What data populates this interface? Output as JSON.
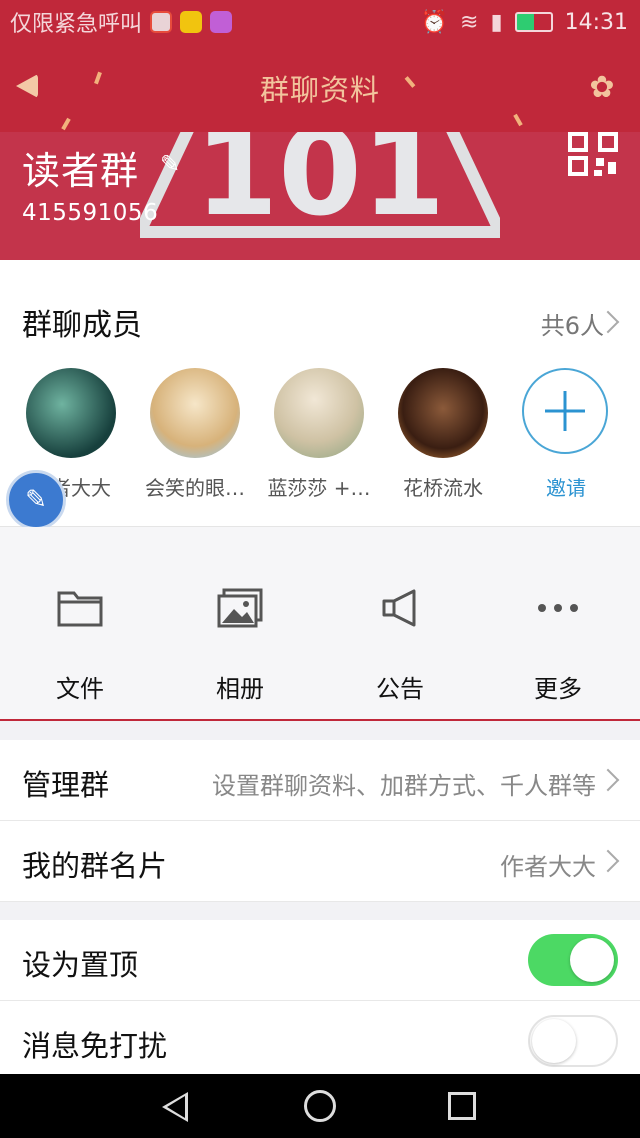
{
  "status_bar": {
    "carrier_text": "仅限紧急呼叫",
    "time": "14:31"
  },
  "navbar": {
    "title": "群聊资料"
  },
  "group": {
    "name": "读者群",
    "id": "415591056",
    "banner_text": "101"
  },
  "members": {
    "title": "群聊成员",
    "count": "共6人",
    "list": [
      {
        "name": "作者大大"
      },
      {
        "name": "会笑的眼…"
      },
      {
        "name": "蓝莎莎 +…"
      },
      {
        "name": "花桥流水"
      }
    ],
    "invite_label": "邀请"
  },
  "actions": [
    {
      "label": "文件",
      "icon": "folder-icon"
    },
    {
      "label": "相册",
      "icon": "album-icon"
    },
    {
      "label": "公告",
      "icon": "megaphone-icon"
    },
    {
      "label": "更多",
      "icon": "more-icon"
    }
  ],
  "settings": {
    "manage": {
      "title": "管理群",
      "value": "设置群聊资料、加群方式、千人群等"
    },
    "card": {
      "title": "我的群名片",
      "value": "作者大大"
    },
    "pin": {
      "title": "设为置顶",
      "enabled": true
    },
    "mute": {
      "title": "消息免打扰",
      "enabled": false
    }
  },
  "colors": {
    "brand_red": "#c0283a",
    "accent_blue": "#2b93d1",
    "toggle_on": "#4cd964"
  }
}
